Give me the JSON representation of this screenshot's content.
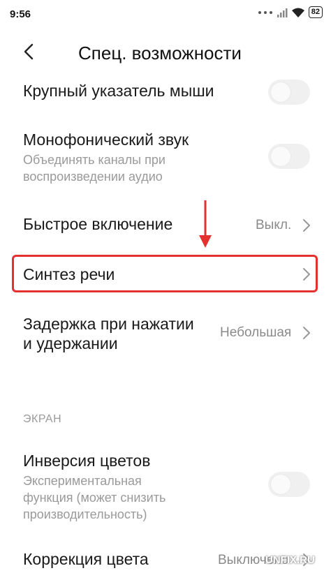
{
  "status_bar": {
    "time": "9:56",
    "battery": "82"
  },
  "header": {
    "title": "Спец. возможности"
  },
  "settings": {
    "large_pointer": {
      "title": "Крупный указатель мыши"
    },
    "mono_audio": {
      "title": "Монофонический звук",
      "subtitle_1": "Объединять каналы при",
      "subtitle_2": "воспроизведении аудио"
    },
    "quick_launch": {
      "title": "Быстрое включение",
      "value": "Выкл."
    },
    "tts": {
      "title": "Синтез речи"
    },
    "touch_delay": {
      "title_1": "Задержка при нажатии",
      "title_2": "и удержании",
      "value": "Небольшая"
    }
  },
  "section_screen": {
    "header": "ЭКРАН"
  },
  "screen": {
    "color_inversion": {
      "title": "Инверсия цветов",
      "subtitle_1": "Экспериментальная",
      "subtitle_2": "функция (может снизить",
      "subtitle_3": "производительность)"
    },
    "color_correction": {
      "title": "Коррекция цвета",
      "value": "Выключено"
    }
  },
  "watermark": "UNFIX.RU",
  "colors": {
    "highlight": "#e53030",
    "text": "#1a1a1a",
    "secondary": "#9a9a9a",
    "toggle_off": "#f0f0f0"
  }
}
